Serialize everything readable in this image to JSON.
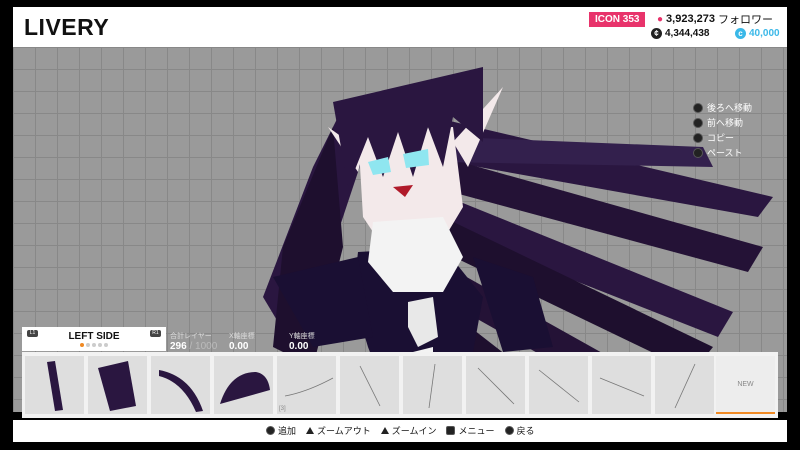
{
  "header": {
    "title": "LIVERY",
    "icon_badge": "ICON 353",
    "followers_count": "3,923,273",
    "followers_label": "フォロワー",
    "credits": "4,344,438",
    "cp": "40,000"
  },
  "context_menu": [
    {
      "icon": "button-icon",
      "label": "後ろへ移動"
    },
    {
      "icon": "button-icon",
      "label": "前へ移動"
    },
    {
      "icon": "button-icon",
      "label": "コピー"
    },
    {
      "icon": "button-icon",
      "label": "ペースト"
    }
  ],
  "side_panel": {
    "title": "LEFT SIDE",
    "lb": "L1",
    "rb": "R1",
    "page_active": 1,
    "page_count": 5
  },
  "stats": {
    "layers_label": "合計レイヤー",
    "layers_value": "296",
    "layers_max": "/ 1000",
    "x_label": "X軸座標",
    "x_value": "0.00",
    "y_label": "Y軸座標",
    "y_value": "0.00"
  },
  "layer_strip": {
    "count_label": "[3]",
    "new_label": "NEW"
  },
  "hints": [
    {
      "icon": "circle-button-icon",
      "label": "追加"
    },
    {
      "icon": "shoulder-button-icon",
      "label": "ズームアウト"
    },
    {
      "icon": "shoulder-button-icon",
      "label": "ズームイン"
    },
    {
      "icon": "options-button-icon",
      "label": "メニュー"
    },
    {
      "icon": "cross-button-icon",
      "label": "戻る"
    }
  ],
  "colors": {
    "accent": "#e8336b",
    "cp": "#3ab8e8",
    "selection": "#f08a24",
    "shape": "#2a1640"
  }
}
